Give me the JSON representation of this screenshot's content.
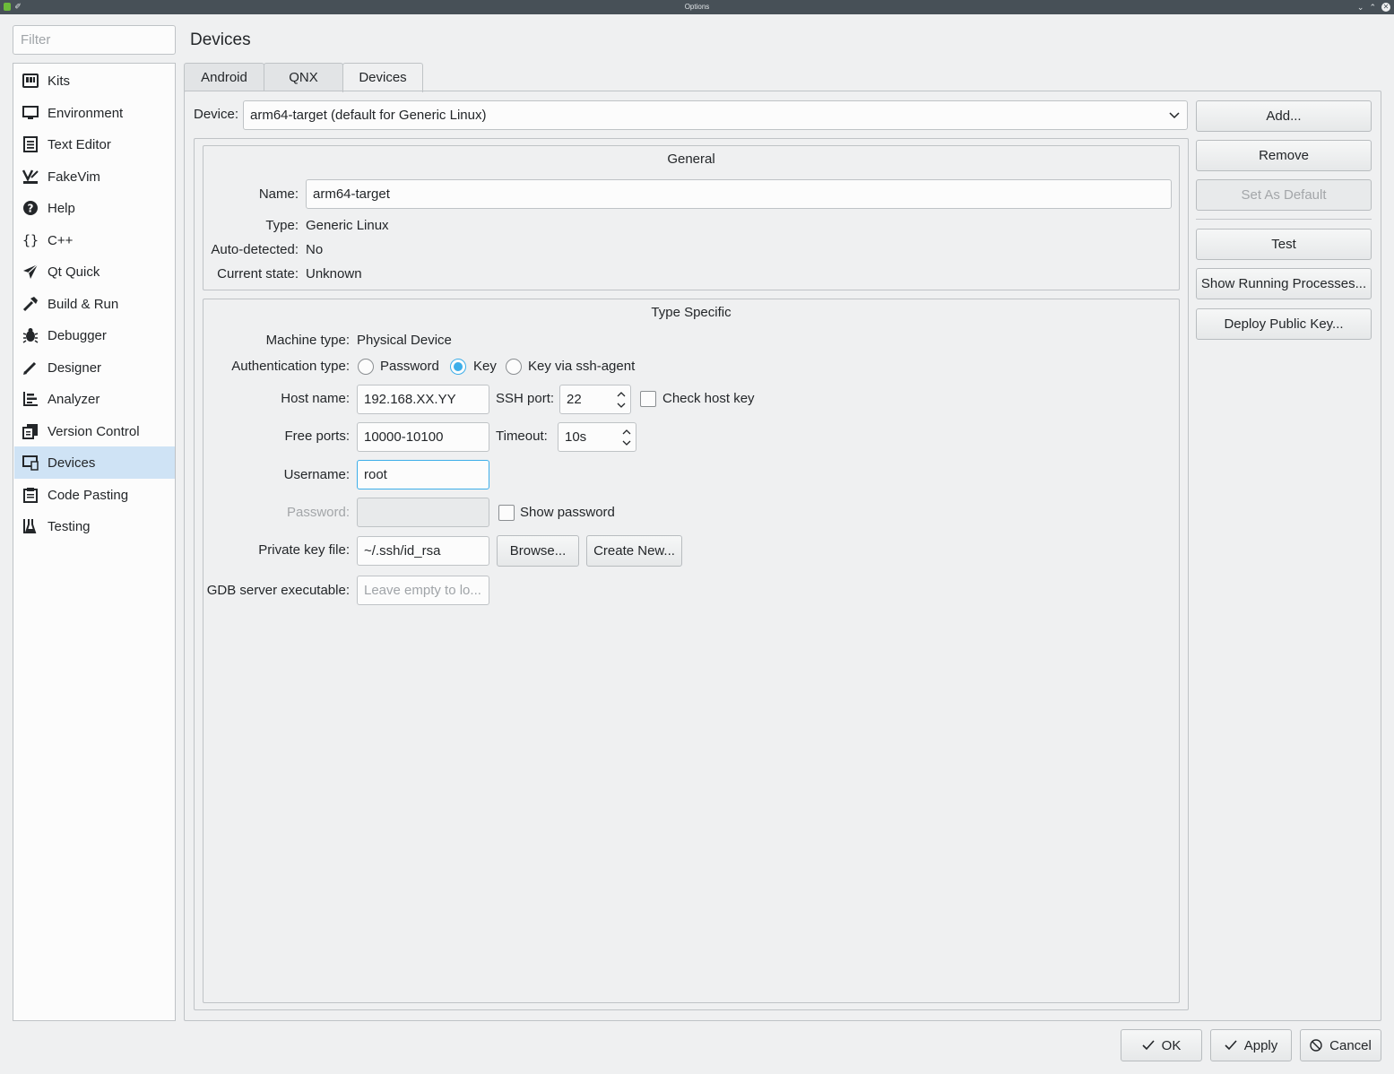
{
  "window": {
    "title": "Options"
  },
  "filter": {
    "placeholder": "Filter"
  },
  "sidebar": {
    "items": [
      {
        "label": "Kits",
        "icon": "kits-icon"
      },
      {
        "label": "Environment",
        "icon": "monitor-icon"
      },
      {
        "label": "Text Editor",
        "icon": "text-editor-icon"
      },
      {
        "label": "FakeVim",
        "icon": "fakevim-icon"
      },
      {
        "label": "Help",
        "icon": "help-icon"
      },
      {
        "label": "C++",
        "icon": "braces-icon"
      },
      {
        "label": "Qt Quick",
        "icon": "paper-plane-icon"
      },
      {
        "label": "Build & Run",
        "icon": "hammer-icon"
      },
      {
        "label": "Debugger",
        "icon": "bug-icon"
      },
      {
        "label": "Designer",
        "icon": "pencil-icon"
      },
      {
        "label": "Analyzer",
        "icon": "analyzer-icon"
      },
      {
        "label": "Version Control",
        "icon": "version-control-icon"
      },
      {
        "label": "Devices",
        "icon": "devices-icon"
      },
      {
        "label": "Code Pasting",
        "icon": "clipboard-icon"
      },
      {
        "label": "Testing",
        "icon": "flask-icon"
      }
    ],
    "selected": "Devices"
  },
  "page": {
    "title": "Devices"
  },
  "tabs": [
    {
      "label": "Android"
    },
    {
      "label": "QNX"
    },
    {
      "label": "Devices"
    }
  ],
  "device_select": {
    "label": "Device:",
    "value": "arm64-target (default for Generic Linux)"
  },
  "side_buttons": {
    "add": "Add...",
    "remove": "Remove",
    "set_default": "Set As Default",
    "test": "Test",
    "show_processes": "Show Running Processes...",
    "deploy_key": "Deploy Public Key..."
  },
  "general": {
    "title": "General",
    "name_label": "Name:",
    "name_value": "arm64-target",
    "type_label": "Type:",
    "type_value": "Generic Linux",
    "auto_label": "Auto-detected:",
    "auto_value": "No",
    "state_label": "Current state:",
    "state_value": "Unknown"
  },
  "type_specific": {
    "title": "Type Specific",
    "machine_label": "Machine type:",
    "machine_value": "Physical Device",
    "auth_label": "Authentication type:",
    "auth_options": [
      "Password",
      "Key",
      "Key via ssh-agent"
    ],
    "auth_selected": "Key",
    "host_label": "Host name:",
    "host_value": "192.168.XX.YY",
    "ssh_port_label": "SSH port:",
    "ssh_port_value": "22",
    "check_host_key_label": "Check host key",
    "check_host_key": false,
    "free_ports_label": "Free ports:",
    "free_ports_value": "10000-10100",
    "timeout_label": "Timeout:",
    "timeout_value": "10s",
    "username_label": "Username:",
    "username_value": "root",
    "password_label": "Password:",
    "password_value": "",
    "show_password_label": "Show password",
    "show_password": false,
    "key_file_label": "Private key file:",
    "key_file_value": "~/.ssh/id_rsa",
    "browse_label": "Browse...",
    "create_new_label": "Create New...",
    "gdb_label": "GDB server executable:",
    "gdb_placeholder": "Leave empty to lo..."
  },
  "dialog_buttons": {
    "ok": "OK",
    "apply": "Apply",
    "cancel": "Cancel"
  },
  "colors": {
    "accent": "#3daee9",
    "selection": "#cfe3f5",
    "background": "#eff0f1"
  }
}
